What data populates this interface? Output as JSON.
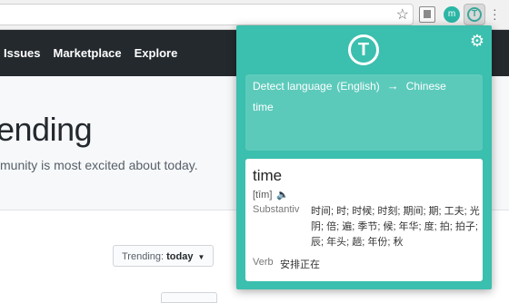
{
  "nav": {
    "items": [
      "Issues",
      "Marketplace",
      "Explore"
    ]
  },
  "hero": {
    "title": "ending",
    "subtitle": "munity is most excited about today."
  },
  "trending": {
    "label": "Trending:",
    "value": "today"
  },
  "popup": {
    "detect_label": "Detect language",
    "detected_lang": "(English)",
    "target_lang": "Chinese",
    "source_text": "time",
    "word": "time",
    "phonetic": "[tīm]",
    "pos1": "Substantiv",
    "defs1": "时间; 时; 时候; 时刻; 期间; 期; 工夫; 光阴; 倍; 遍; 季节; 候; 年华; 度; 拍; 拍子; 辰; 年头; 趟; 年份; 秋",
    "pos2": "Verb",
    "defs2": "安排正在"
  },
  "colors": {
    "header_bg": "#24292e",
    "popup_bg": "#3bbfae",
    "card_bg": "#5ccabb"
  }
}
